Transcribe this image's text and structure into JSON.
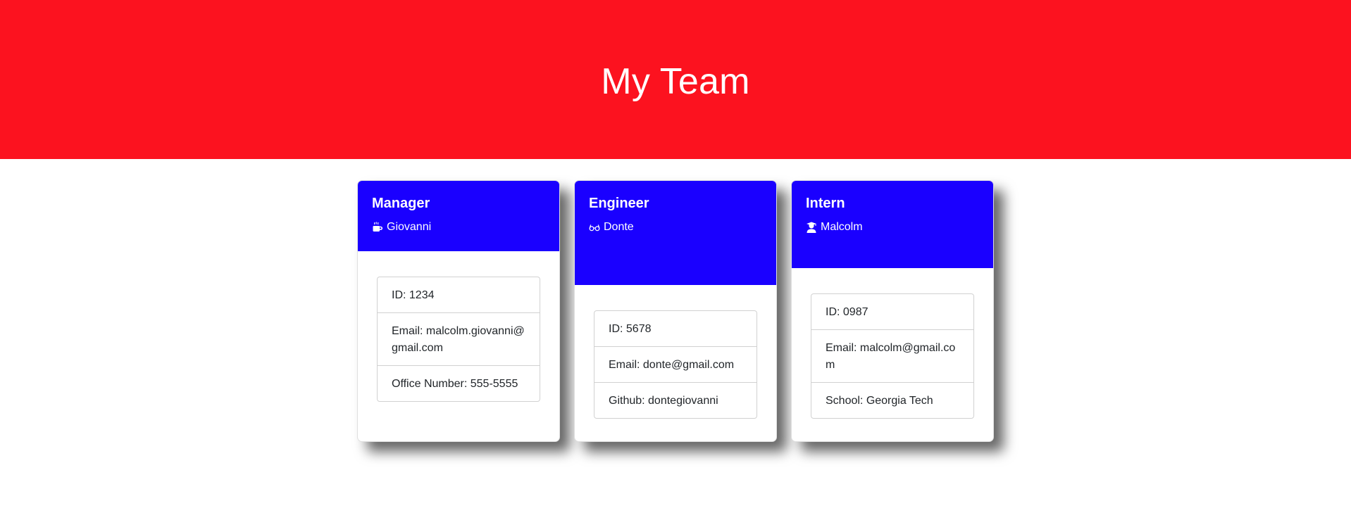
{
  "page": {
    "title": "My Team",
    "colors": {
      "hero_bg": "#fc121f",
      "card_header_bg": "#1a00ff",
      "text_on_color": "#ffffff"
    }
  },
  "cards": [
    {
      "role": "Manager",
      "icon": "coffee-mug-icon",
      "name": "Giovanni",
      "rows": [
        "ID: 1234",
        "Email: malcolm.giovanni@gmail.com",
        "Office Number: 555-5555"
      ]
    },
    {
      "role": "Engineer",
      "icon": "glasses-icon",
      "name": "Donte",
      "rows": [
        "ID: 5678",
        "Email: donte@gmail.com",
        "Github: dontegiovanni"
      ]
    },
    {
      "role": "Intern",
      "icon": "graduate-user-icon",
      "name": "Malcolm",
      "rows": [
        "ID: 0987",
        "Email: malcolm@gmail.com",
        "School: Georgia Tech"
      ]
    }
  ]
}
